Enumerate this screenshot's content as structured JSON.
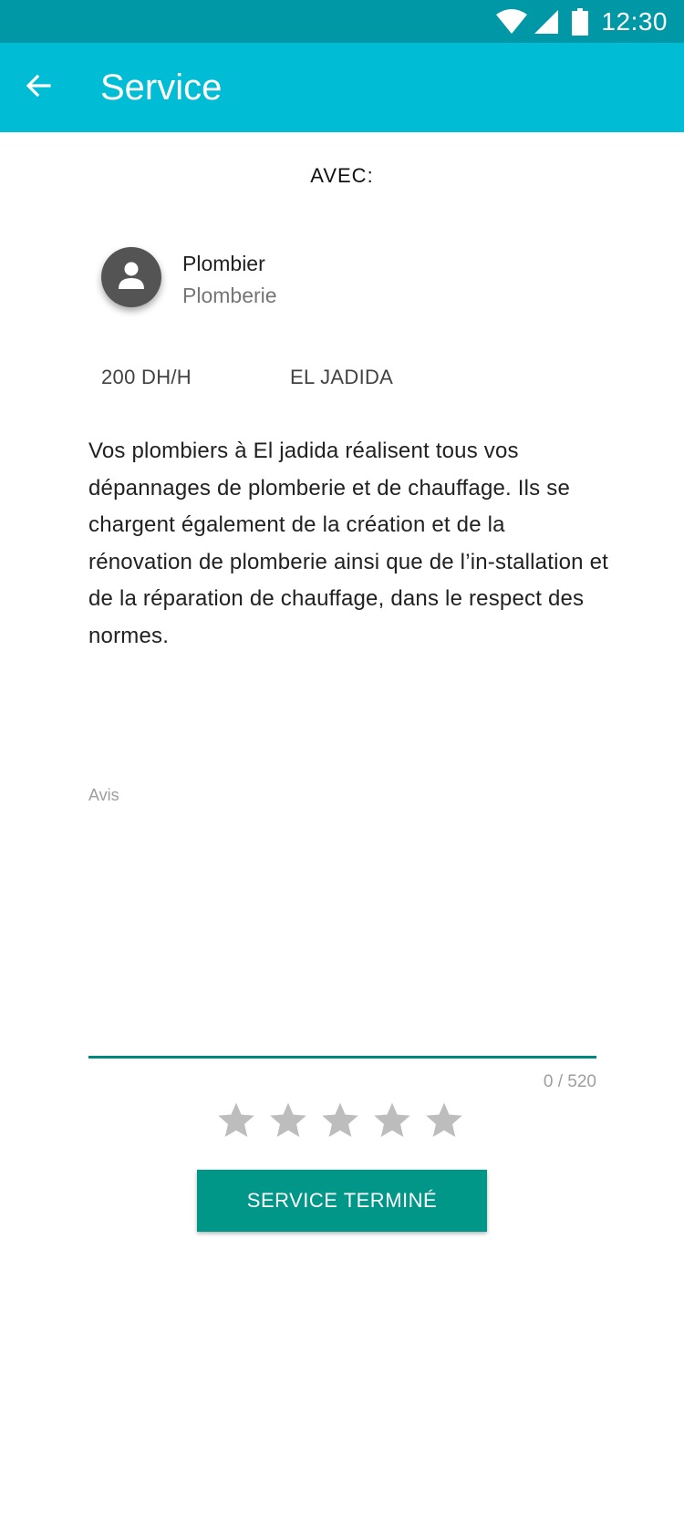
{
  "status_bar": {
    "time": "12:30",
    "icons": [
      "wifi-icon",
      "cell-signal-icon",
      "battery-icon"
    ]
  },
  "app_bar": {
    "title": "Service",
    "back_icon": "arrow-left-icon"
  },
  "content": {
    "with_label": "AVEC:",
    "provider": {
      "name": "Plombier",
      "category": "Plomberie",
      "avatar_icon": "person-icon"
    },
    "rate": "200 DH/H",
    "city": "EL JADIDA",
    "description": "Vos plombiers à El jadida réalisent tous vos dépannages de plomberie et de chauffage. Ils se chargent également de la création et de la rénovation de plomberie ainsi que de l’in-stallation et de la réparation de chauffage, dans le respect des normes."
  },
  "review": {
    "label": "Avis",
    "value": "",
    "counter": "0 / 520",
    "rating": 0,
    "max_rating": 5
  },
  "actions": {
    "done_label": "SERVICE TERMINÉ"
  },
  "colors": {
    "status_bar": "#0097a7",
    "app_bar": "#00bcd4",
    "accent": "#009688",
    "star_inactive": "#bdbdbd"
  }
}
